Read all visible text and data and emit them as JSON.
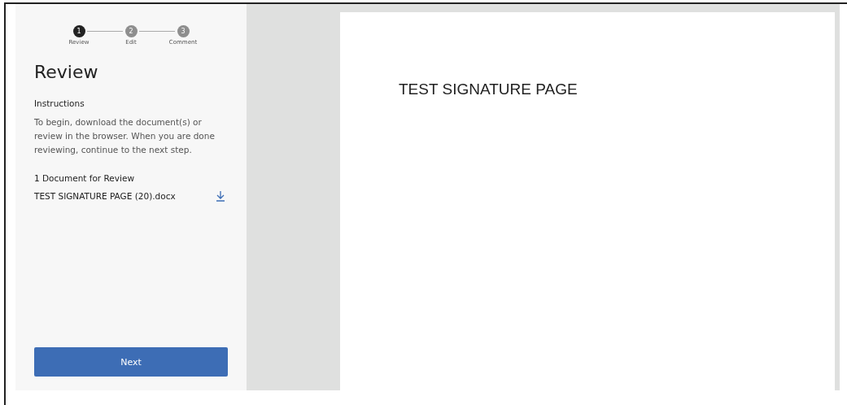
{
  "steps": [
    {
      "number": "1",
      "label": "Review",
      "selected": true
    },
    {
      "number": "2",
      "label": "Edit",
      "selected": false
    },
    {
      "number": "3",
      "label": "Comment",
      "selected": false
    }
  ],
  "sidebar": {
    "title": "Review",
    "instructions_heading": "Instructions",
    "instructions": "To begin, download the document(s) or review in the browser. When you are done reviewing, continue to the next step.",
    "documents_heading": "1 Document for Review",
    "documents": [
      {
        "name": "TEST SIGNATURE PAGE (20).docx"
      }
    ],
    "next_button": "Next"
  },
  "document": {
    "heading": "TEST SIGNATURE PAGE"
  }
}
